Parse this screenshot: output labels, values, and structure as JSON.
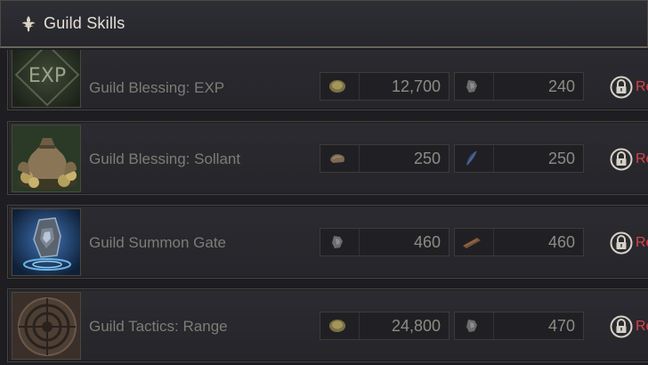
{
  "header": {
    "title": "Guild Skills",
    "icon": "fleur-de-lis-icon"
  },
  "skills": [
    {
      "name": "Guild Blessing: EXP",
      "icon": "exp-icon",
      "thumb_text": "EXP",
      "costs": [
        {
          "icon": "coin-icon",
          "value": "12,700"
        },
        {
          "icon": "ore-icon",
          "value": "240"
        }
      ],
      "lock_text": "Re"
    },
    {
      "name": "Guild Blessing: Sollant",
      "icon": "money-bags-icon",
      "costs": [
        {
          "icon": "hide-icon",
          "value": "250"
        },
        {
          "icon": "feather-icon",
          "value": "250"
        }
      ],
      "lock_text": "Re"
    },
    {
      "name": "Guild Summon Gate",
      "icon": "summon-stone-icon",
      "costs": [
        {
          "icon": "ore-icon",
          "value": "460"
        },
        {
          "icon": "wood-icon",
          "value": "460"
        }
      ],
      "lock_text": "Re"
    },
    {
      "name": "Guild Tactics: Range",
      "icon": "target-icon",
      "costs": [
        {
          "icon": "coin-icon",
          "value": "24,800"
        },
        {
          "icon": "ore-icon",
          "value": "470"
        }
      ],
      "lock_text": "Re"
    }
  ],
  "colors": {
    "lock_red": "#d9424a",
    "text_muted": "#7f7c76",
    "title": "#e6e1d6"
  }
}
